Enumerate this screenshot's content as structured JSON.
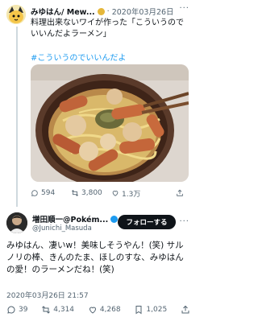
{
  "tweet1": {
    "author_name": "みゆはん/ Mew...",
    "date": "2020年03月26日",
    "more_label": "···",
    "text": "料理出来ないワイが作った「こういうのでいいんだよラーメン」",
    "hashtag": "#こういうのでいいんだよ",
    "image_alt": "ramen-photo",
    "stats": {
      "replies": "594",
      "retweets": "3,800",
      "likes": "1.3万"
    }
  },
  "tweet2": {
    "author_name": "増田順一@Pokém...",
    "handle": "@Junichi_Masuda",
    "follow_label": "フォローする",
    "more_label": "···",
    "text": "みゆはん、凄いw！美味しそうやん！(笑) サルノリの棒、きんのたま、ほしのすな、みゆはんの愛！のラーメンだね！(笑)",
    "date": "2020年03月26日 21:57",
    "stats": {
      "replies": "39",
      "retweets": "4,314",
      "likes": "4,268",
      "bookmarks": "1,025"
    }
  },
  "colors": {
    "link": "#1d9bf0",
    "follow_bg": "#0f1419",
    "muted": "#536471",
    "verified_gold": "#e5b73b",
    "verified_blue": "#1d9bf0"
  }
}
